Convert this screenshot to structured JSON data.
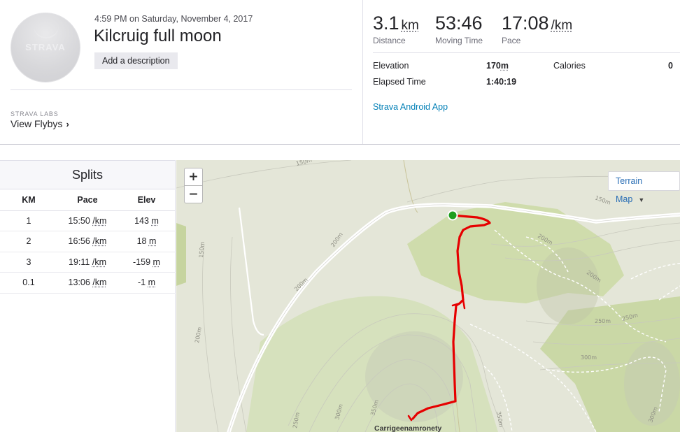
{
  "activity": {
    "date": "4:59 PM on Saturday, November 4, 2017",
    "title": "Kilcruig full moon",
    "add_description_label": "Add a description",
    "avatar_logo": "STRAVA"
  },
  "labs": {
    "kicker": "STRAVA LABS",
    "flybys_label": "View Flybys",
    "chevron": "›"
  },
  "stats": {
    "distance": {
      "value": "3.1",
      "unit": "km",
      "label": "Distance"
    },
    "moving_time": {
      "value": "53:46",
      "label": "Moving Time"
    },
    "pace": {
      "value": "17:08",
      "unit": "/km",
      "label": "Pace"
    },
    "elevation": {
      "label": "Elevation",
      "value": "170",
      "unit": "m"
    },
    "calories": {
      "label": "Calories",
      "value": "0"
    },
    "elapsed": {
      "label": "Elapsed Time",
      "value": "1:40:19"
    },
    "device_link": "Strava Android App"
  },
  "splits": {
    "title": "Splits",
    "columns": [
      "KM",
      "Pace",
      "Elev"
    ],
    "rows": [
      {
        "km": "1",
        "pace": "15:50",
        "pace_unit": "/km",
        "elev": "143",
        "elev_unit": "m"
      },
      {
        "km": "2",
        "pace": "16:56",
        "pace_unit": "/km",
        "elev": "18",
        "elev_unit": "m"
      },
      {
        "km": "3",
        "pace": "19:11",
        "pace_unit": "/km",
        "elev": "-159",
        "elev_unit": "m"
      },
      {
        "km": "0.1",
        "pace": "13:06",
        "pace_unit": "/km",
        "elev": "-1",
        "elev_unit": "m"
      }
    ]
  },
  "map": {
    "zoom_in": "+",
    "zoom_out": "−",
    "terrain_label": "Terrain Map",
    "terrain_caret": "▼",
    "place_name": "Carrigeenamronety",
    "contour_labels": [
      "150m",
      "150m",
      "150m",
      "200m",
      "200m",
      "200m",
      "200m",
      "200m",
      "250m",
      "250m",
      "300m",
      "300m",
      "300m",
      "350m",
      "350m",
      "250m"
    ],
    "route_color": "#e60000",
    "start_color": "#1f9e1f"
  }
}
